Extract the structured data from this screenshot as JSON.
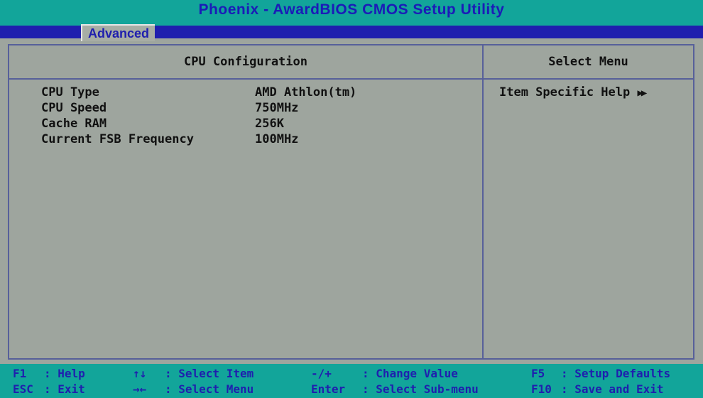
{
  "app": {
    "title": "Phoenix - AwardBIOS CMOS Setup Utility"
  },
  "tabs": [
    {
      "label": "Advanced",
      "active": true
    }
  ],
  "main": {
    "header": "CPU Configuration",
    "items": [
      {
        "label": "CPU Type",
        "value": "AMD Athlon(tm)"
      },
      {
        "label": "CPU Speed",
        "value": "750MHz"
      },
      {
        "label": "Cache RAM",
        "value": "256K"
      },
      {
        "label": "Current FSB Frequency",
        "value": "100MHz"
      }
    ]
  },
  "help": {
    "header": "Select Menu",
    "text": "Item Specific Help",
    "icon": "double-right-arrow-icon"
  },
  "footer": {
    "row1": [
      {
        "key": "F1",
        "desc": ": Help"
      },
      {
        "key": "↑↓",
        "desc": ": Select Item"
      },
      {
        "key": "-/+",
        "desc": ": Change Value"
      },
      {
        "key": "F5",
        "desc": ": Setup Defaults"
      }
    ],
    "row2": [
      {
        "key": "ESC",
        "desc": ": Exit"
      },
      {
        "key": "→←",
        "desc": ": Select Menu"
      },
      {
        "key": "Enter",
        "desc": ": Select Sub-menu"
      },
      {
        "key": "F10",
        "desc": ": Save and Exit"
      }
    ]
  },
  "colors": {
    "background": "#9ea59e",
    "title_bar": "#12a59a",
    "tab_strip": "#1f1fae",
    "text": "#111111",
    "footer_text": "#1f1fae"
  }
}
